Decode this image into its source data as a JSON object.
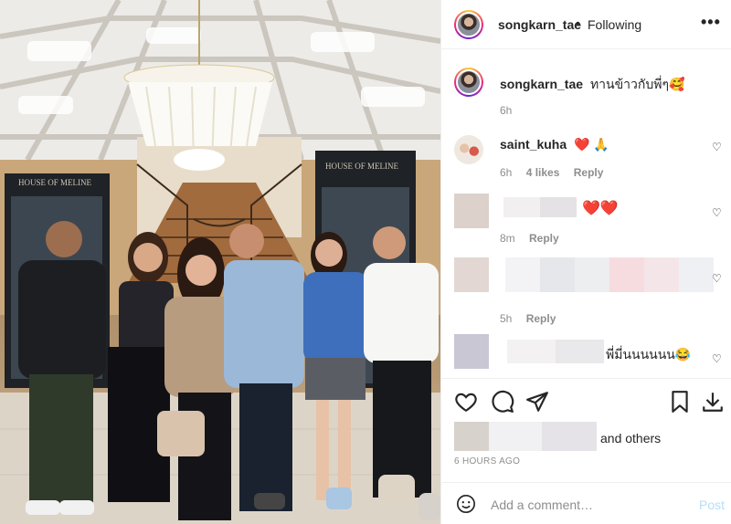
{
  "header": {
    "username": "songkarn_tae",
    "separator": "•",
    "follow_status": "Following",
    "more_label": "•••"
  },
  "caption": {
    "username": "songkarn_tae",
    "text": "ทานข้าวกับพี่ๆ🥰",
    "time": "6h"
  },
  "comments": [
    {
      "username": "saint_kuha",
      "text": "❤️ 🙏",
      "time": "6h",
      "likes": "4 likes",
      "reply": "Reply"
    },
    {
      "username": "",
      "text": "❤️❤️",
      "time": "8m",
      "reply": "Reply"
    },
    {
      "username": "",
      "text": "",
      "time": "5h",
      "reply": "Reply"
    },
    {
      "username": "",
      "text": "พี่มี่นนนนนน😂"
    }
  ],
  "likes": {
    "text": "and others"
  },
  "time_ago": "6 HOURS AGO",
  "add_comment": {
    "placeholder": "Add a comment…",
    "post_label": "Post"
  },
  "photo": {
    "sign_left": "HOUSE OF MELINE",
    "sign_right": "HOUSE OF MELINE"
  },
  "colors": {
    "heart_red": "#ed1c24",
    "post_blue": "#b2dffc",
    "meta_gray": "#8e8e8e"
  }
}
